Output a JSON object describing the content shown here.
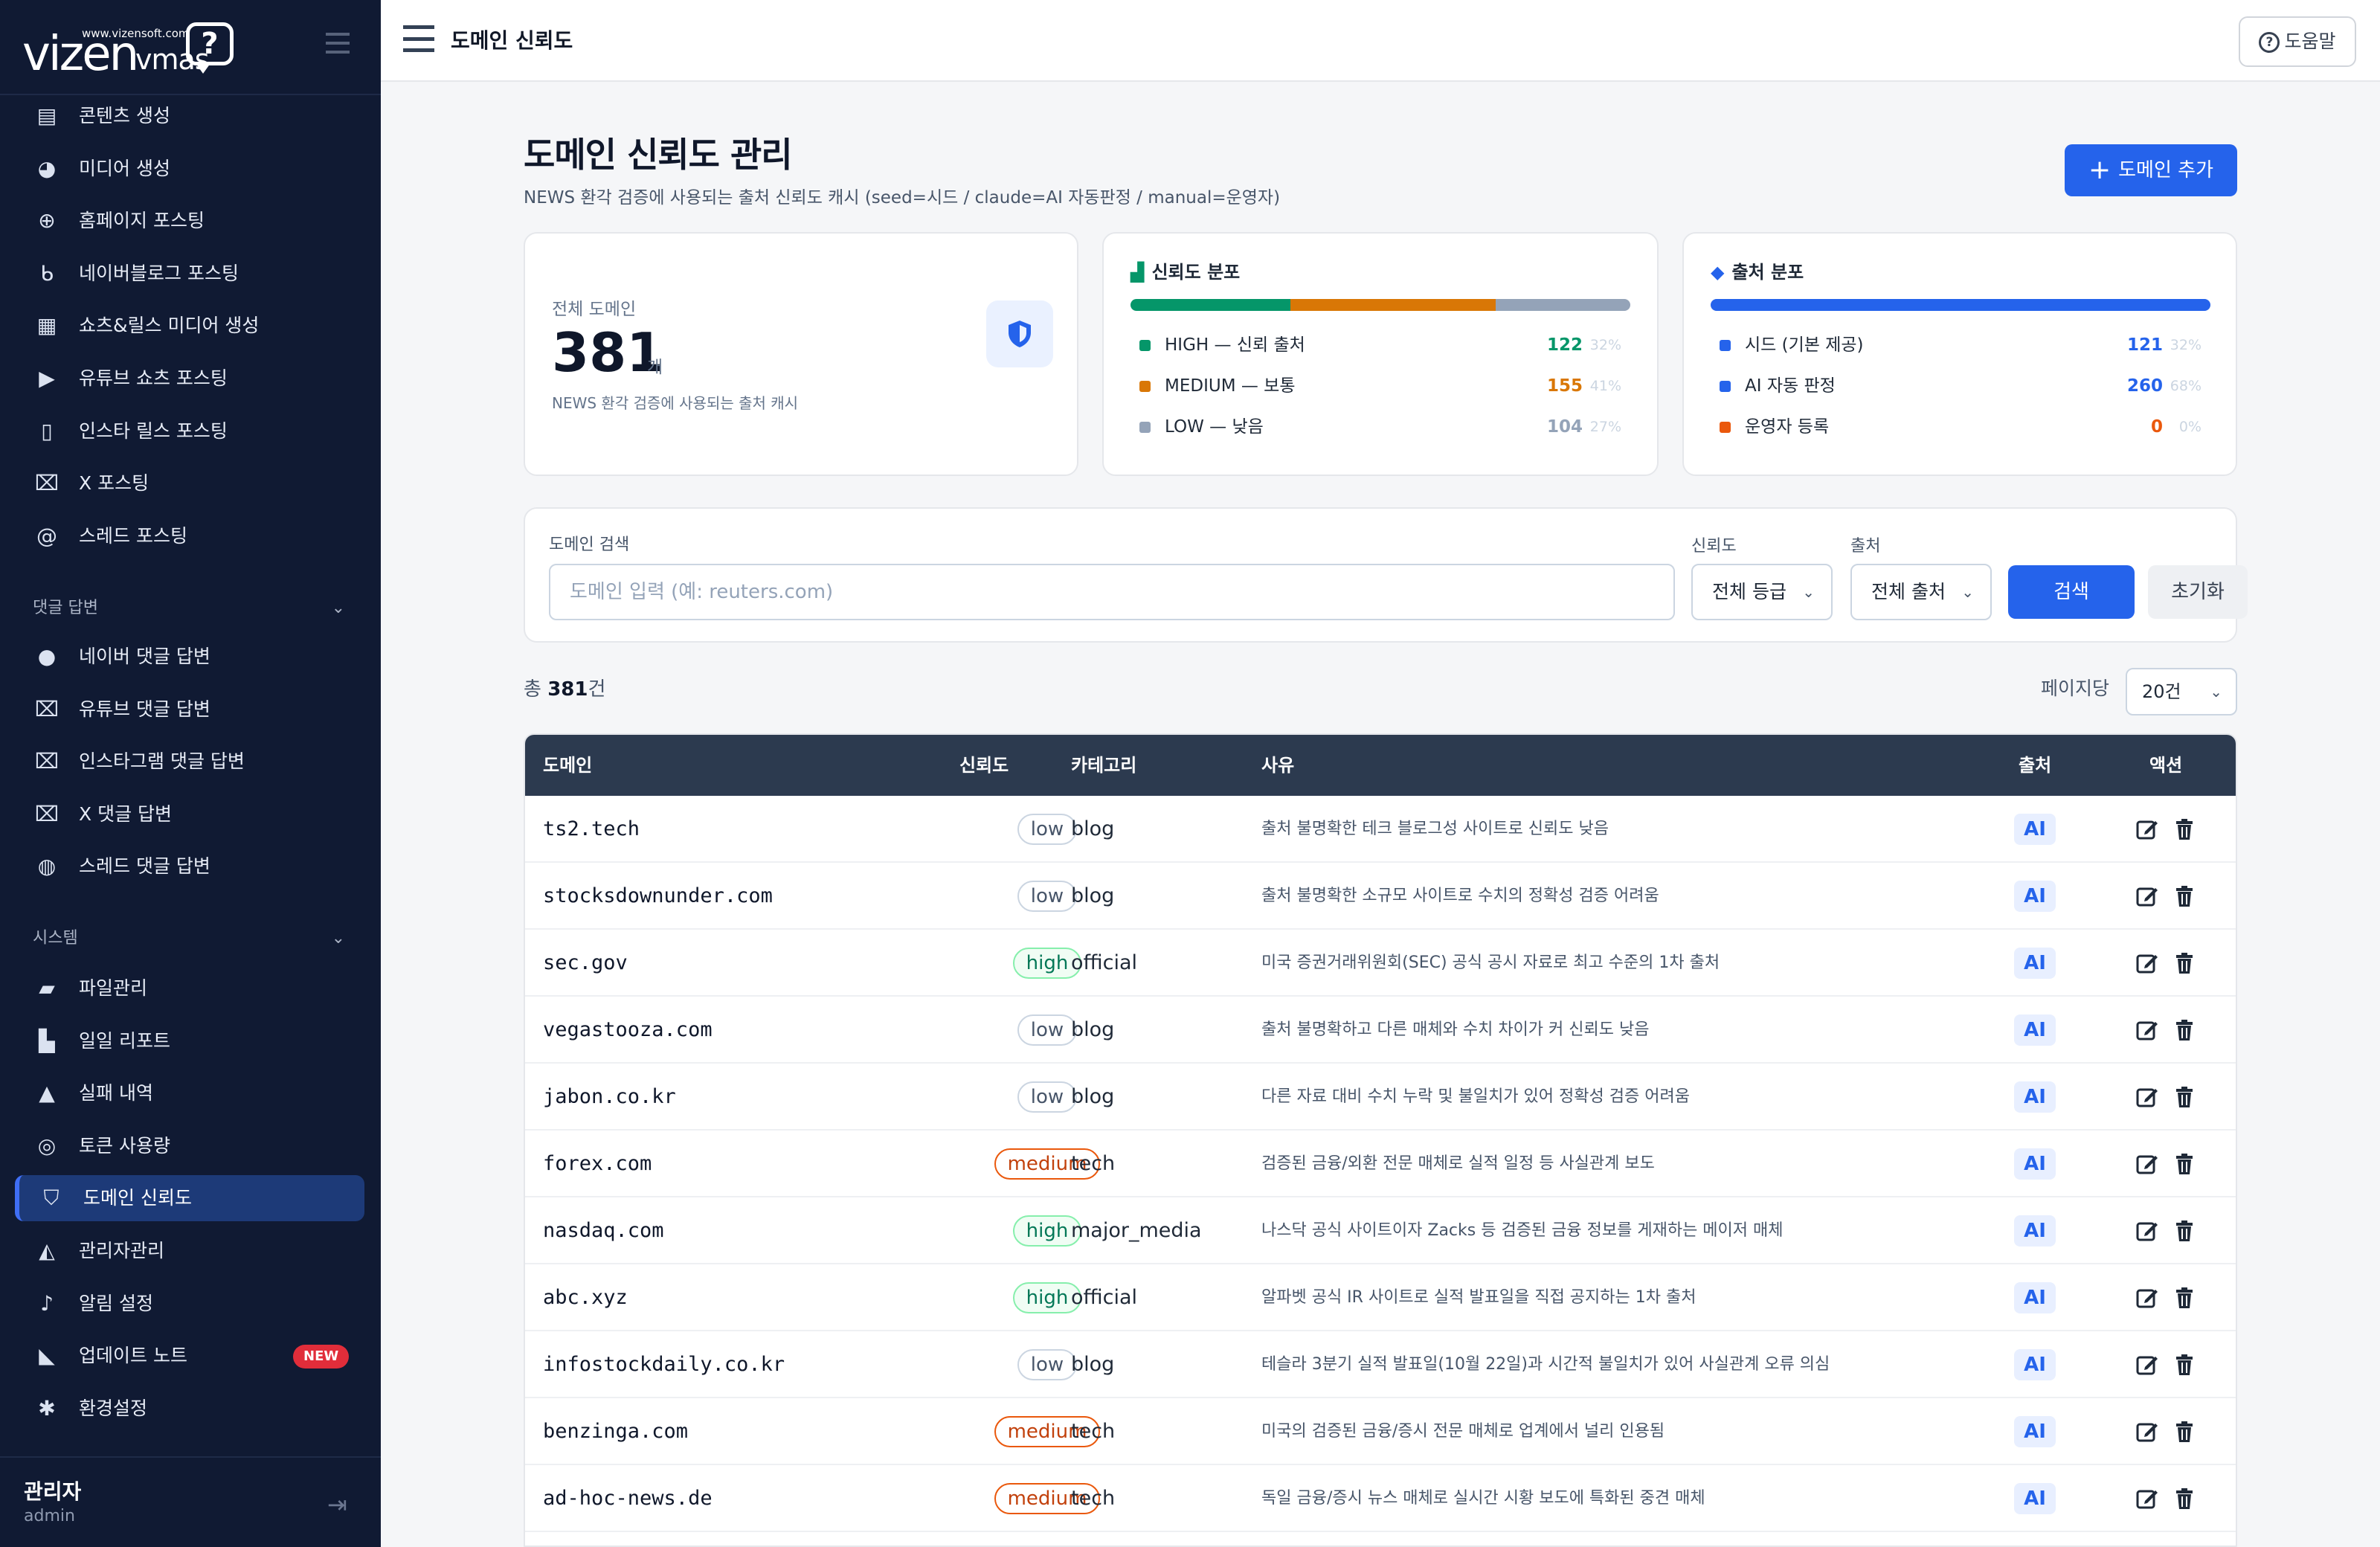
{
  "brand": {
    "url": "www.vizensoft.com",
    "name": "vizen",
    "sub": "vmas",
    "bubble": "?"
  },
  "sidebar": {
    "items_top": [
      {
        "label": "콘텐츠 생성",
        "icon": "newspaper-icon"
      },
      {
        "label": "미디어 생성",
        "icon": "palette-icon"
      },
      {
        "label": "홈페이지 포스팅",
        "icon": "globe-icon"
      },
      {
        "label": "네이버블로그 포스팅",
        "icon": "blog-icon"
      },
      {
        "label": "쇼츠&릴스 미디어 생성",
        "icon": "clapperboard-icon"
      },
      {
        "label": "유튜브 쇼츠 포스팅",
        "icon": "play-icon"
      },
      {
        "label": "인스타 릴스 포스팅",
        "icon": "mobile-icon"
      },
      {
        "label": "X 포스팅",
        "icon": "x-logo-icon"
      },
      {
        "label": "스레드 포스팅",
        "icon": "at-icon"
      }
    ],
    "section_comments": "댓글 답변",
    "items_comments": [
      {
        "label": "네이버 댓글 답변",
        "icon": "comment-dots-icon"
      },
      {
        "label": "유튜브 댓글 답변",
        "icon": "x-logo-icon"
      },
      {
        "label": "인스타그램 댓글 답변",
        "icon": "x-logo-icon"
      },
      {
        "label": "X 댓글 답변",
        "icon": "x-logo-icon"
      },
      {
        "label": "스레드 댓글 답변",
        "icon": "comments-icon"
      }
    ],
    "section_system": "시스템",
    "items_system": [
      {
        "label": "파일관리",
        "icon": "folder-open-icon"
      },
      {
        "label": "일일 리포트",
        "icon": "chart-bar-icon"
      },
      {
        "label": "실패 내역",
        "icon": "warning-icon"
      },
      {
        "label": "토큰 사용량",
        "icon": "coins-icon"
      },
      {
        "label": "도메인 신뢰도",
        "icon": "shield-icon",
        "active": true
      },
      {
        "label": "관리자관리",
        "icon": "user-gear-icon"
      },
      {
        "label": "알림 설정",
        "icon": "bell-icon"
      },
      {
        "label": "업데이트 노트",
        "icon": "megaphone-icon",
        "badge": "NEW"
      },
      {
        "label": "환경설정",
        "icon": "gear-icon"
      }
    ],
    "user": {
      "name": "관리자",
      "role": "admin"
    }
  },
  "topbar": {
    "title": "도메인 신뢰도",
    "help": "도움말"
  },
  "page": {
    "title": "도메인 신뢰도 관리",
    "subtitle": "NEWS 환각 검증에 사용되는 출처 신뢰도 캐시 (seed=시드 / claude=AI 자동판정 / manual=운영자)",
    "add_button": "도메인 추가"
  },
  "stats": {
    "total": {
      "label": "전체 도메인",
      "value": "381",
      "unit": "개",
      "desc": "NEWS 환각 검증에 사용되는 출처 캐시"
    },
    "trust": {
      "title": "신뢰도 분포",
      "rows": [
        {
          "label": "HIGH — 신뢰 출처",
          "value": "122",
          "pct": "32%",
          "color": "#059669",
          "frac": 0.32
        },
        {
          "label": "MEDIUM — 보통",
          "value": "155",
          "pct": "41%",
          "color": "#d97706",
          "frac": 0.41
        },
        {
          "label": "LOW — 낮음",
          "value": "104",
          "pct": "27%",
          "color": "#94a3b8",
          "frac": 0.27
        }
      ]
    },
    "source": {
      "title": "출처 분포",
      "rows": [
        {
          "label": "시드 (기본 제공)",
          "value": "121",
          "pct": "32%",
          "color": "#2563eb"
        },
        {
          "label": "AI 자동 판정",
          "value": "260",
          "pct": "68%",
          "color": "#2563eb"
        },
        {
          "label": "운영자 등록",
          "value": "0",
          "pct": "0%",
          "color": "#ea580c"
        }
      ]
    }
  },
  "filters": {
    "search_label": "도메인 검색",
    "search_placeholder": "도메인 입력 (예: reuters.com)",
    "trust_label": "신뢰도",
    "trust_value": "전체 등급",
    "source_label": "출처",
    "source_value": "전체 출처",
    "search_btn": "검색",
    "reset_btn": "초기화"
  },
  "list": {
    "total_prefix": "총 ",
    "total_count": "381",
    "total_suffix": "건",
    "perpage_label": "페이지당",
    "perpage_value": "20건"
  },
  "table": {
    "headers": {
      "domain": "도메인",
      "trust": "신뢰도",
      "category": "카테고리",
      "reason": "사유",
      "source": "출처",
      "action": "액션"
    },
    "rows": [
      {
        "domain": "ts2.tech",
        "trust": "low",
        "category": "blog",
        "reason": "출처 불명확한 테크 블로그성 사이트로 신뢰도 낮음",
        "source": "AI"
      },
      {
        "domain": "stocksdownunder.com",
        "trust": "low",
        "category": "blog",
        "reason": "출처 불명확한 소규모 사이트로 수치의 정확성 검증 어려움",
        "source": "AI"
      },
      {
        "domain": "sec.gov",
        "trust": "high",
        "category": "official",
        "reason": "미국 증권거래위원회(SEC) 공식 공시 자료로 최고 수준의 1차 출처",
        "source": "AI"
      },
      {
        "domain": "vegastooza.com",
        "trust": "low",
        "category": "blog",
        "reason": "출처 불명확하고 다른 매체와 수치 차이가 커 신뢰도 낮음",
        "source": "AI"
      },
      {
        "domain": "jabon.co.kr",
        "trust": "low",
        "category": "blog",
        "reason": "다른 자료 대비 수치 누락 및 불일치가 있어 정확성 검증 어려움",
        "source": "AI"
      },
      {
        "domain": "forex.com",
        "trust": "medium",
        "category": "tech",
        "reason": "검증된 금융/외환 전문 매체로 실적 일정 등 사실관계 보도",
        "source": "AI"
      },
      {
        "domain": "nasdaq.com",
        "trust": "high",
        "category": "major_media",
        "reason": "나스닥 공식 사이트이자 Zacks 등 검증된 금융 정보를 게재하는 메이저 매체",
        "source": "AI"
      },
      {
        "domain": "abc.xyz",
        "trust": "high",
        "category": "official",
        "reason": "알파벳 공식 IR 사이트로 실적 발표일을 직접 공지하는 1차 출처",
        "source": "AI"
      },
      {
        "domain": "infostockdaily.co.kr",
        "trust": "low",
        "category": "blog",
        "reason": "테슬라 3분기 실적 발표일(10월 22일)과 시간적 불일치가 있어 사실관계 오류 의심",
        "source": "AI"
      },
      {
        "domain": "benzinga.com",
        "trust": "medium",
        "category": "tech",
        "reason": "미국의 검증된 금융/증시 전문 매체로 업계에서 널리 인용됨",
        "source": "AI"
      },
      {
        "domain": "ad-hoc-news.de",
        "trust": "medium",
        "category": "tech",
        "reason": "독일 금융/증시 뉴스 매체로 실시간 시황 보도에 특화된 중견 매체",
        "source": "AI"
      }
    ]
  }
}
